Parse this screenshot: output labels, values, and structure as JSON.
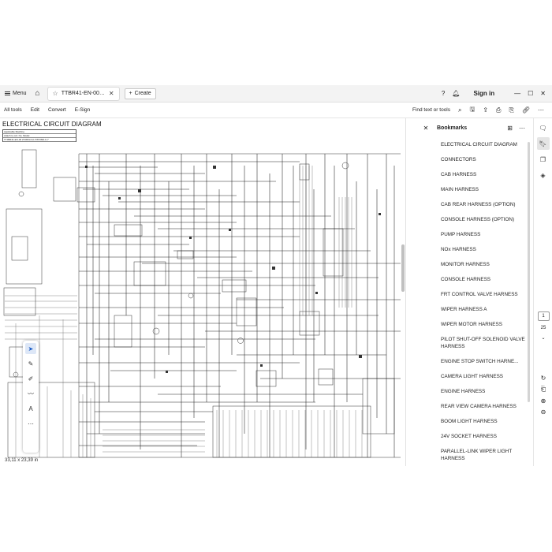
{
  "tabbar": {
    "menu_label": "Menu",
    "tab_title": "TTBR41-EN-00_Circuit(...",
    "create_label": "Create",
    "sign_in_label": "Sign in"
  },
  "toolbar": {
    "menus": [
      "All tools",
      "Edit",
      "Convert",
      "E-Sign"
    ],
    "find_label": "Find text or tools"
  },
  "document": {
    "title": "ELECTRICAL CIRCUIT DIAGRAM",
    "applicable_label": "Applicable Machine",
    "table_rows": [
      "Attach to ord. No.   Model",
      "TTJBR41-EN-00    ZX360LCH-7/ZX360LC-7"
    ],
    "page_size": "33,11 x 23,39 in"
  },
  "bookmarks": {
    "title": "Bookmarks",
    "items": [
      "ELECTRICAL CIRCUIT DIAGRAM",
      "CONNECTORS",
      "CAB HARNESS",
      "MAIN HARNESS",
      "CAB REAR HARNESS (OPTION)",
      "CONSOLE HARNESS (OPTION)",
      "PUMP HARNESS",
      "NOx HARNESS",
      "MONITOR HARNESS",
      "CONSOLE HARNESS",
      "FRT CONTROL VALVE HARNESS",
      "WIPER HARNESS A",
      "WIPER MOTOR HARNESS",
      "PILOT SHUT-OFF SOLENOID VALVE HARNESS",
      "ENGINE STOP SWITCH HARNE...",
      "CAMERA LIGHT HARNESS",
      "ENGINE HARNESS",
      "REAR VIEW CAMERA HARNESS",
      "BOOM LIGHT HARNESS",
      "24V SOCKET HARNESS",
      "PARALLEL-LINK WIPER LIGHT HARNESS"
    ]
  },
  "page_nav": {
    "current_page": "1",
    "total_pages": "25"
  },
  "colors": {
    "tabbar_bg": "#f3f3f3",
    "active_tool": "#1a5bc4"
  }
}
